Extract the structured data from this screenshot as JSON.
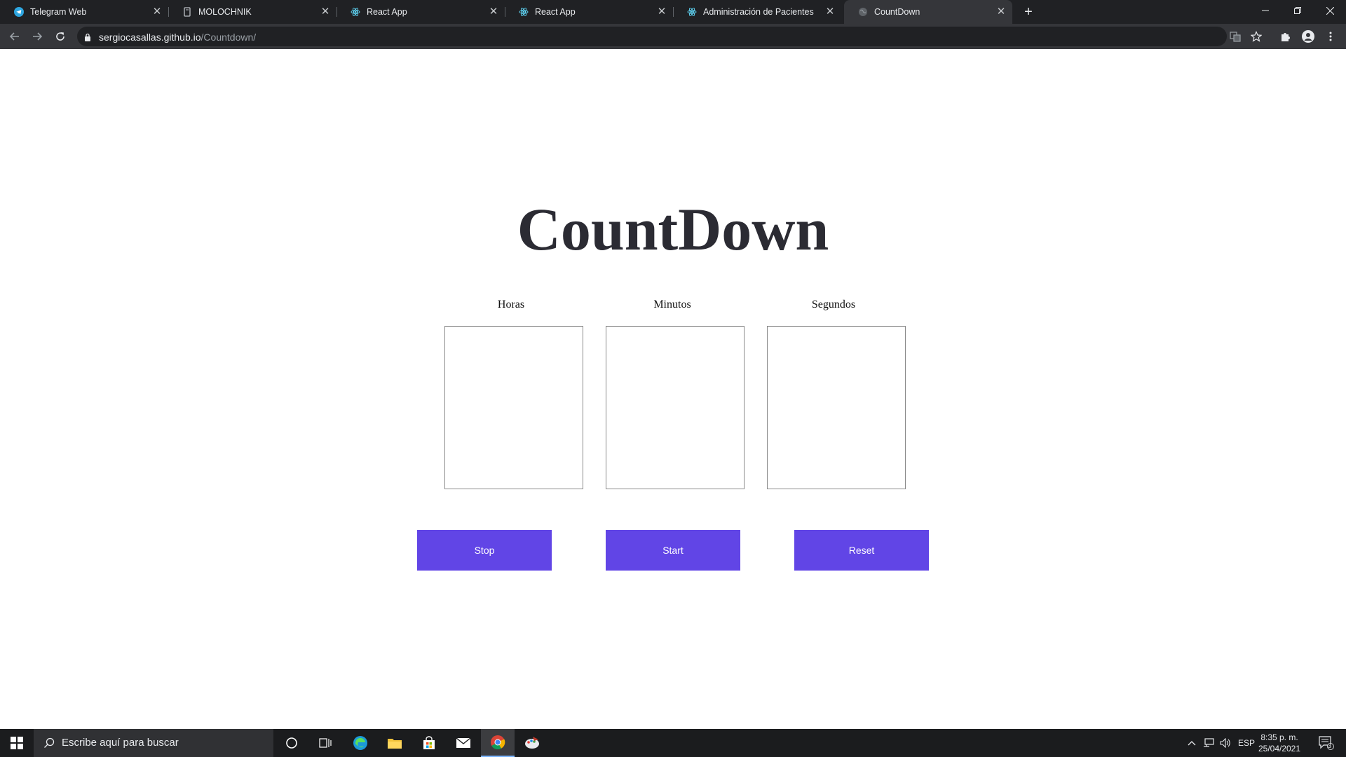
{
  "browser": {
    "tabs": [
      {
        "title": "Telegram Web",
        "icon": "telegram-icon"
      },
      {
        "title": "MOLOCHNIK",
        "icon": "page-icon"
      },
      {
        "title": "React App",
        "icon": "react-icon"
      },
      {
        "title": "React App",
        "icon": "react-icon"
      },
      {
        "title": "Administración de Pacientes",
        "icon": "react-icon"
      },
      {
        "title": "CountDown",
        "icon": "globe-icon"
      }
    ],
    "url_host": "sergiocasallas.github.io",
    "url_path": "/Countdown/"
  },
  "page": {
    "title": "CountDown",
    "labels": {
      "hours": "Horas",
      "minutes": "Minutos",
      "seconds": "Segundos"
    },
    "values": {
      "hours": "",
      "minutes": "",
      "seconds": ""
    },
    "buttons": {
      "stop": "Stop",
      "start": "Start",
      "reset": "Reset"
    },
    "button_color": "#6145e6"
  },
  "taskbar": {
    "search_placeholder": "Escribe aquí para buscar",
    "language": "ESP",
    "time": "8:35 p. m.",
    "date": "25/04/2021",
    "notification_count": "3"
  }
}
